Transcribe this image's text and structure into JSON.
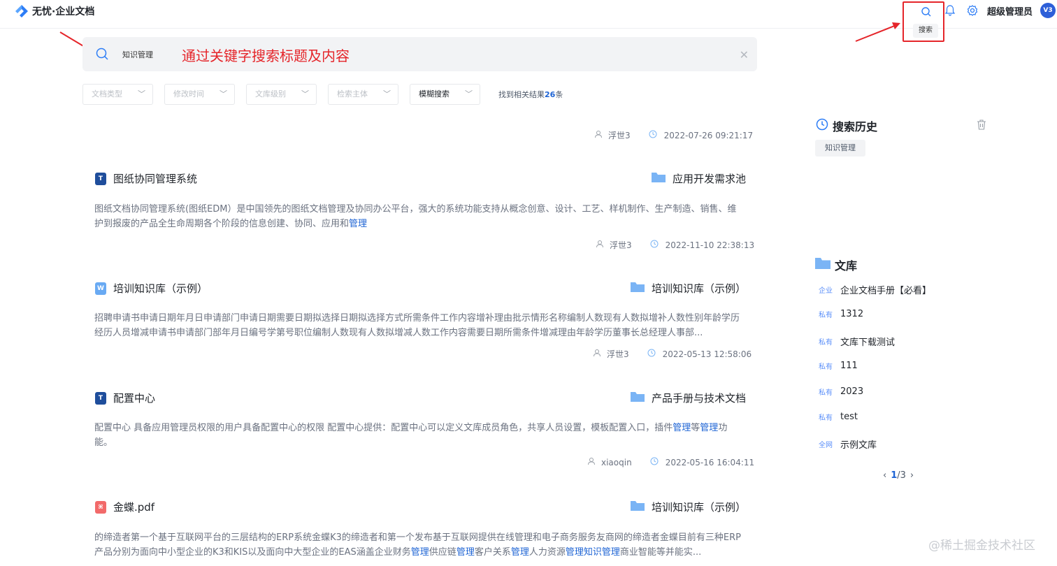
{
  "app": {
    "title": "无忧·企业文档"
  },
  "header": {
    "search_tooltip": "搜索",
    "user_name": "超级管理员",
    "avatar_text": "V3"
  },
  "search": {
    "query": "知识管理",
    "annotation": "通过关键字搜索标题及内容"
  },
  "filters": {
    "items": [
      "文档类型",
      "修改时间",
      "文库级别",
      "检索主体",
      "模糊搜索"
    ],
    "found_prefix": "找到相关结果",
    "found_count": "26",
    "found_suffix": "条"
  },
  "top_meta": {
    "user": "浮世3",
    "time": "2022-07-26 09:21:17"
  },
  "results": [
    {
      "title": "图纸协同管理系统",
      "type": "T",
      "folder": "应用开发需求池",
      "desc_plain": "图纸文档协同管理系统(图纸EDM）是中国领先的图纸文档管理及协同办公平台，强大的系统功能支持从概念创意、设计、工艺、样机制作、生产制造、销售、维护到报废的产品全生命周期各个阶段的信息创建、协同、应用和",
      "desc_hl": "管理",
      "user": "浮世3",
      "time": "2022-11-10 22:38:13"
    },
    {
      "title": "培训知识库（示例）",
      "type": "W",
      "folder": "培训知识库（示例）",
      "desc_plain": "招聘申请书申请日期年月日申请部门申请日期需要日期拟选择日期拟选择方式所需条件工作内容增补理由批示情形名称编制人数现有人数拟增补人数性别年龄学历经历人员增减申请书申请部门部年月日编号学第号职位编制人数现有人数拟增减人数工作内容需要日期所需条件增减理由年龄学历董事长总经理人事部...",
      "user": "浮世3",
      "time": "2022-05-13 12:58:06"
    },
    {
      "title": "配置中心",
      "type": "T",
      "folder": "产品手册与技术文档",
      "desc_a": "配置中心 具备应用管理员权限的用户具备配置中心的权限 配置中心提供：配置中心可以定义文库成员角色，共享人员设置，模板配置入口，插件",
      "desc_h1": "管理",
      "desc_b": "等",
      "desc_h2": "管理",
      "desc_c": "功能。",
      "user": "xiaoqin",
      "time": "2022-05-16 16:04:11"
    },
    {
      "title": "金蝶.pdf",
      "type": "pdf",
      "folder": "培训知识库（示例）",
      "desc_a": "的缔造者第一个基于互联网平台的三层结构的ERP系统金蝶K3的缔造者和第一个发布基于互联网提供在线管理和电子商务服务友商网的缔造者金蝶目前有三种ERP产品分别为面向中小型企业的K3和KIS以及面向中大型企业的EAS涵盖企业财务",
      "desc_h1": "管理",
      "desc_b": "供应链",
      "desc_h2": "管理",
      "desc_c": "客户关系",
      "desc_h3": "管理",
      "desc_d": "人力资源",
      "desc_h4": "管理知识管理",
      "desc_e": "商业智能等并能实..."
    }
  ],
  "history": {
    "title": "搜索历史",
    "items": [
      "知识管理"
    ]
  },
  "library": {
    "title": "文库",
    "items": [
      {
        "badge": "企业",
        "name": "企业文档手册【必看】"
      },
      {
        "badge": "私有",
        "name": "1312"
      },
      {
        "badge": "私有",
        "name": "文库下载测试"
      },
      {
        "badge": "私有",
        "name": "111"
      },
      {
        "badge": "私有",
        "name": "2023"
      },
      {
        "badge": "私有",
        "name": "test"
      },
      {
        "badge": "全网",
        "name": "示例文库"
      }
    ],
    "page_current": "1",
    "page_total": "/3"
  },
  "watermark": "@稀土掘金技术社区",
  "colors": {
    "accent": "#1d63d4",
    "annotation": "#e5252a",
    "folder": "#7ab4f5"
  }
}
